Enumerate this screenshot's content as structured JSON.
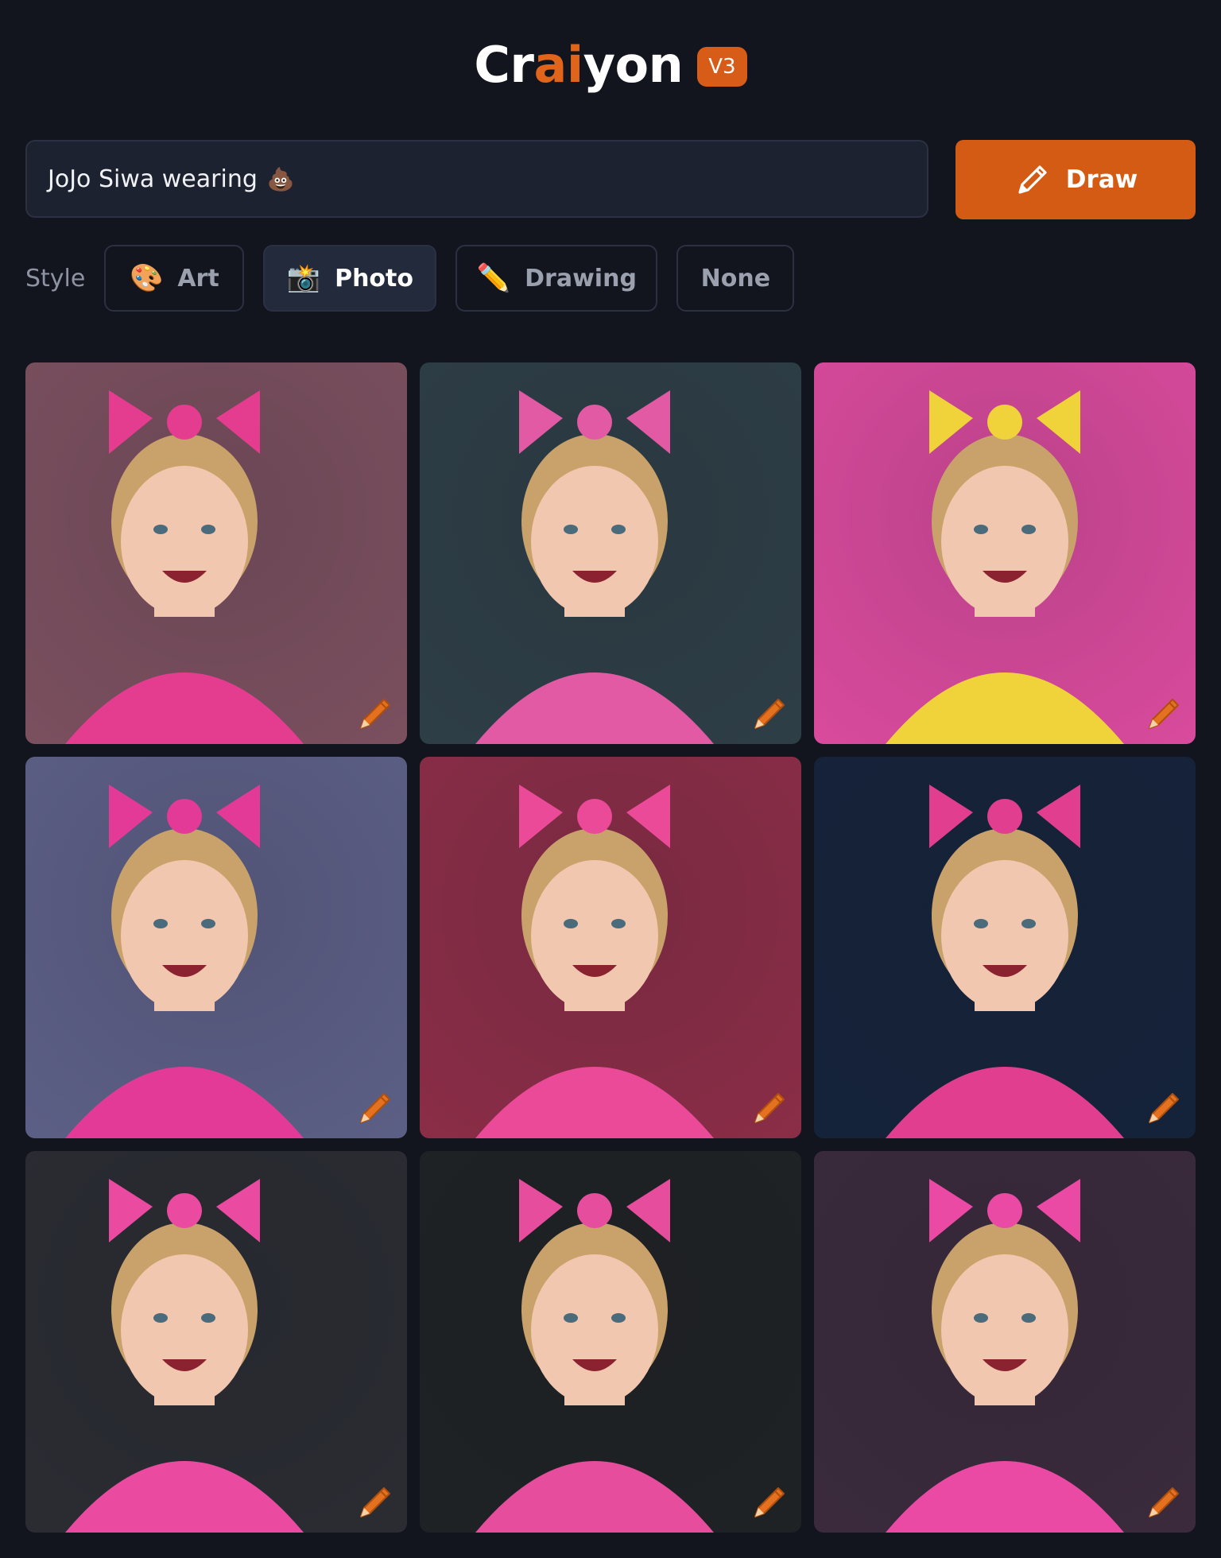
{
  "header": {
    "logo_part1": "Cr",
    "logo_part2": "ai",
    "logo_part3": "yon",
    "version": "V3"
  },
  "prompt": {
    "value": "JoJo Siwa wearing",
    "emoji": "💩"
  },
  "draw_button": {
    "label": "Draw",
    "icon": "pencil-icon"
  },
  "style": {
    "label": "Style",
    "options": [
      {
        "label": "Art",
        "icon": "🎨",
        "selected": false
      },
      {
        "label": "Photo",
        "icon": "📸",
        "selected": true
      },
      {
        "label": "Drawing",
        "icon": "✏️",
        "selected": false
      },
      {
        "label": "None",
        "icon": "",
        "selected": false
      }
    ]
  },
  "colors": {
    "background": "#12151e",
    "accent": "#d35b14",
    "input_bg": "#1d2230",
    "chip_selected_bg": "#232a3b"
  },
  "images": [
    {
      "bg": "#7a4f5e",
      "accent": "#e43c8f"
    },
    {
      "bg": "#2e3e46",
      "accent": "#e25aa3"
    },
    {
      "bg": "#d84a9c",
      "accent": "#f0d23a"
    },
    {
      "bg": "#5c5f85",
      "accent": "#e23a96"
    },
    {
      "bg": "#8a2d47",
      "accent": "#ea4a98"
    },
    {
      "bg": "#15233a",
      "accent": "#e23e8f"
    },
    {
      "bg": "#2a2c32",
      "accent": "#ea4aa0"
    },
    {
      "bg": "#1f2224",
      "accent": "#e64d9d"
    },
    {
      "bg": "#3a2a3c",
      "accent": "#ea4aa4"
    }
  ]
}
